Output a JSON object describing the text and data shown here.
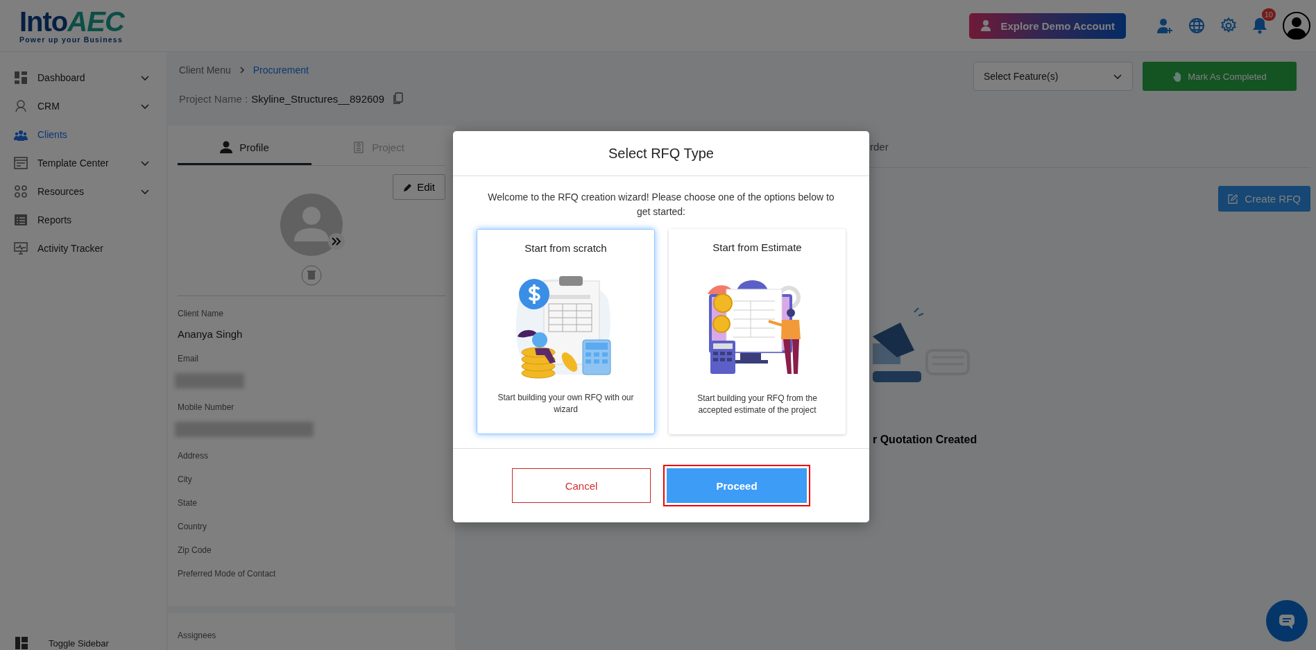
{
  "header": {
    "logo": {
      "wordmark": "Into",
      "wordmark_accent": "AEC",
      "tagline": "Power up your Business"
    },
    "demo_button": "Explore Demo Account",
    "notification_count": "10"
  },
  "sidebar": {
    "items": [
      {
        "label": "Dashboard",
        "selected": false,
        "expandable": true
      },
      {
        "label": "CRM",
        "selected": false,
        "expandable": true
      },
      {
        "label": "Clients",
        "selected": true,
        "expandable": false
      },
      {
        "label": "Template Center",
        "selected": false,
        "expandable": true
      },
      {
        "label": "Resources",
        "selected": false,
        "expandable": true
      },
      {
        "label": "Reports",
        "selected": false,
        "expandable": false
      },
      {
        "label": "Activity Tracker",
        "selected": false,
        "expandable": false
      }
    ],
    "toggle": "Toggle Sidebar"
  },
  "breadcrumb": [
    {
      "label": "Client Menu",
      "current": false
    },
    {
      "label": "Procurement",
      "current": true
    }
  ],
  "project": {
    "label": "Project Name :",
    "value": "Skyline_Structures__892609"
  },
  "feature_select": {
    "placeholder": "Select Feature(s)"
  },
  "mark_completed_button": "Mark As Completed",
  "profile_card": {
    "tabs": [
      {
        "label": "Profile",
        "selected": true
      },
      {
        "label": "Project",
        "selected": false
      }
    ],
    "edit_button": "Edit",
    "fields": [
      {
        "label": "Client Name",
        "value": "Ananya Singh",
        "redacted": false
      },
      {
        "label": "Email",
        "redacted": true
      },
      {
        "label": "Mobile Number",
        "redacted": true
      },
      {
        "label": "Address",
        "redacted": false
      },
      {
        "label": "City",
        "redacted": false
      },
      {
        "label": "State",
        "redacted": false
      },
      {
        "label": "Country",
        "redacted": false
      },
      {
        "label": "Zip Code",
        "redacted": false
      },
      {
        "label": "Preferred Mode of Contact",
        "redacted": false
      }
    ]
  },
  "assignees_card": {
    "label": "Assignees"
  },
  "procurement": {
    "tab_fragment": "rder",
    "create_rfq_button": "Create RFQ",
    "empty_state_fragment": "r Quotation Created"
  },
  "modal": {
    "title": "Select RFQ Type",
    "intro": "Welcome to the RFQ creation wizard! Please choose one of the options below to get started:",
    "options": [
      {
        "kind": "scratch",
        "title": "Start from scratch",
        "description": "Start building your own RFQ with our wizard",
        "selected": true
      },
      {
        "kind": "estimate",
        "title": "Start from Estimate",
        "description": "Start building your RFQ from the accepted estimate of the project",
        "selected": false
      }
    ],
    "cancel_button": "Cancel",
    "proceed_button": {
      "label": "Proceed",
      "focused": true
    }
  }
}
